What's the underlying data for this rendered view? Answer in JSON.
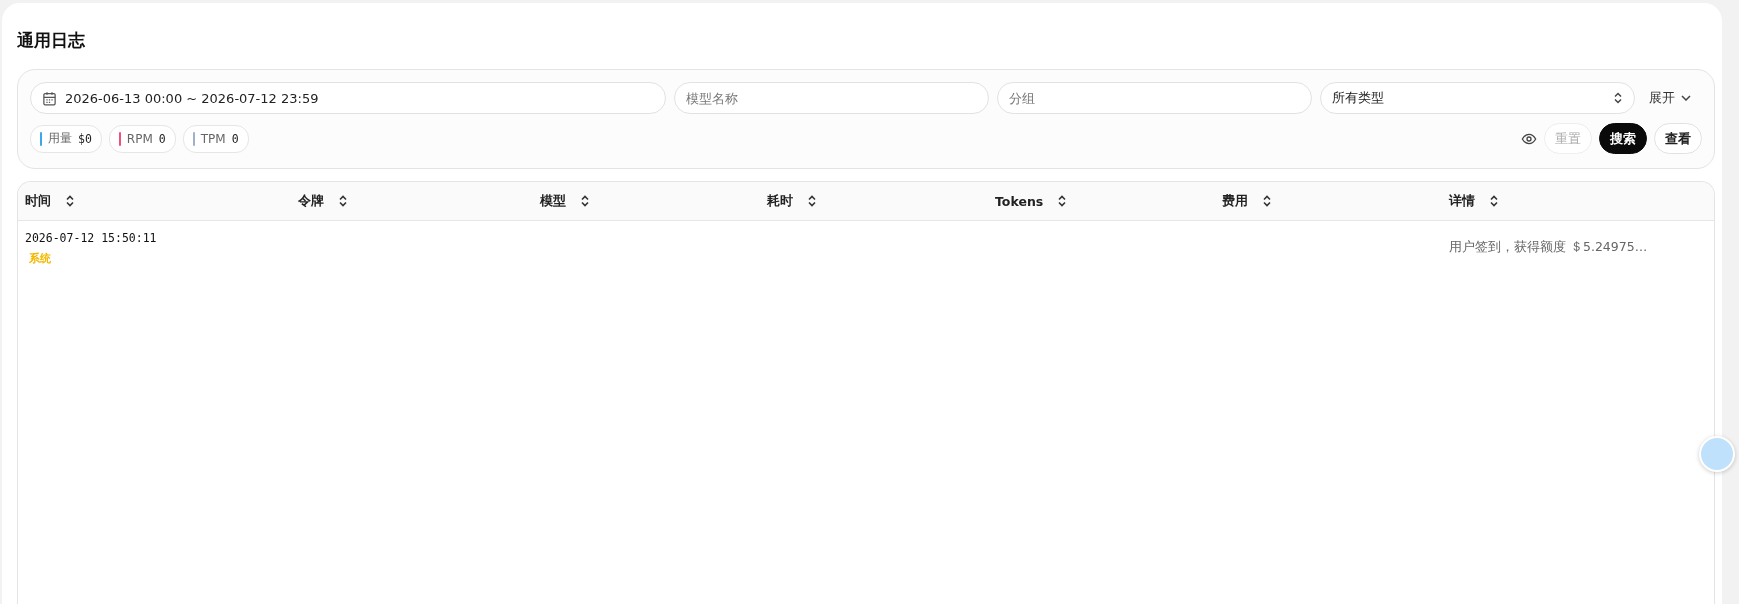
{
  "page_title": "通用日志",
  "filters": {
    "date_range": "2026-06-13 00:00 ~ 2026-07-12 23:59",
    "model_placeholder": "模型名称",
    "group_placeholder": "分组",
    "type_value": "所有类型",
    "expand_label": "展开"
  },
  "stats": [
    {
      "label": "用量",
      "value": "$0",
      "color": "#3aa8eb"
    },
    {
      "label": "RPM",
      "value": "0",
      "color": "#f2507b"
    },
    {
      "label": "TPM",
      "value": "0",
      "color": "#9fb0c8"
    }
  ],
  "actions": {
    "reset": "重置",
    "search": "搜索",
    "view": "查看"
  },
  "table": {
    "columns": [
      "时间",
      "令牌",
      "模型",
      "耗时",
      "Tokens",
      "费用",
      "详情"
    ],
    "rows": [
      {
        "time": "2026-07-12 15:50:11",
        "type_tag": "系统",
        "details": "用户签到，获得额度 ＄5.24975…"
      }
    ]
  }
}
